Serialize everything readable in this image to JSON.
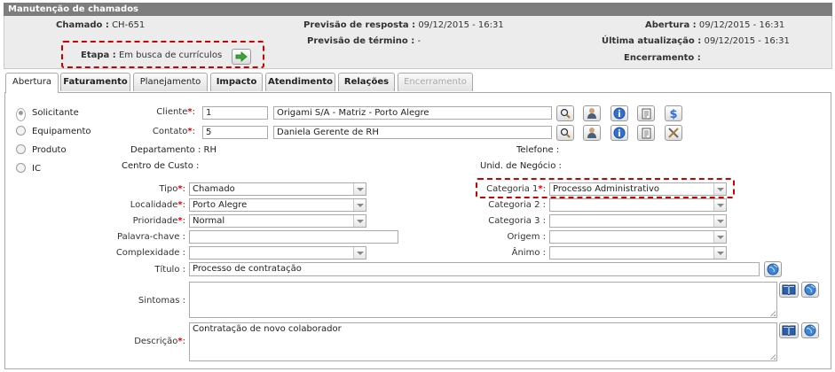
{
  "window_title": "Manutenção de chamados",
  "header": {
    "chamado_label": "Chamado :",
    "chamado_value": "CH-651",
    "prev_resposta_label": "Previsão de resposta :",
    "prev_resposta_value": "09/12/2015 - 16:31",
    "abertura_label": "Abertura :",
    "abertura_value": "09/12/2015 - 16:31",
    "prev_termino_label": "Previsão de término :",
    "prev_termino_value": "-",
    "ultima_label": "Última atualização :",
    "ultima_value": "09/12/2015 - 16:31",
    "etapa_label": "Etapa :",
    "etapa_value": "Em busca de currículos",
    "encerramento_label": "Encerramento :",
    "encerramento_value": ""
  },
  "tabs": [
    "Abertura",
    "Faturamento",
    "Planejamento",
    "Impacto",
    "Atendimento",
    "Relações",
    "Encerramento"
  ],
  "requester_types": [
    "Solicitante",
    "Equipamento",
    "Produto",
    "IC"
  ],
  "form": {
    "cliente_label": "Cliente",
    "cliente_code": "1",
    "cliente_name": "Origami S/A - Matriz - Porto Alegre",
    "contato_label": "Contato",
    "contato_code": "5",
    "contato_name": "Daniela Gerente de RH",
    "departamento_label": "Departamento :",
    "departamento_value": "RH",
    "telefone_label": "Telefone :",
    "telefone_value": "",
    "centro_label": "Centro de Custo :",
    "centro_value": "",
    "unid_label": "Unid. de Negócio :",
    "unid_value": "",
    "tipo_label": "Tipo",
    "tipo_value": "Chamado",
    "categoria1_label": "Categoria 1",
    "categoria1_value": "Processo Administrativo",
    "localidade_label": "Localidade",
    "localidade_value": "Porto Alegre",
    "categoria2_label": "Categoria 2 :",
    "categoria2_value": "",
    "prioridade_label": "Prioridade",
    "prioridade_value": "Normal",
    "categoria3_label": "Categoria 3 :",
    "categoria3_value": "",
    "palavra_label": "Palavra-chave :",
    "palavra_value": "",
    "origem_label": "Origem :",
    "origem_value": "",
    "complexidade_label": "Complexidade :",
    "complexidade_value": "",
    "animo_label": "Ânimo :",
    "animo_value": "",
    "titulo_label": "Título :",
    "titulo_value": "Processo de contratação",
    "sintomas_label": "Sintomas :",
    "sintomas_value": "",
    "descricao_label": "Descrição",
    "descricao_value": "Contratação de novo colaborador"
  },
  "icons": [
    "search-icon",
    "person-icon",
    "info-icon",
    "notes-icon",
    "money-icon",
    "tools-icon",
    "book-icon",
    "globe-icon",
    "arrow-right-icon"
  ]
}
